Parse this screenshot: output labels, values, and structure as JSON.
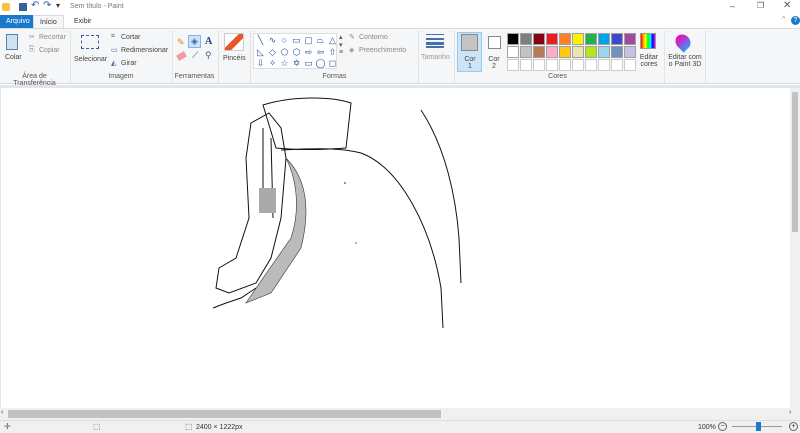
{
  "title": "Sem título - Paint",
  "tabs": {
    "file": "Arquivo",
    "home": "Início",
    "view": "Exibir"
  },
  "clipboard": {
    "paste": "Colar",
    "cut": "Recortar",
    "copy": "Copiar",
    "group": "Área de Transferência"
  },
  "image": {
    "select": "Selecionar",
    "crop": "Cortar",
    "resize": "Redimensionar",
    "rotate": "Girar",
    "group": "Imagem"
  },
  "tools": {
    "group": "Ferramentas"
  },
  "brushes": {
    "label": "Pincéis"
  },
  "shapes": {
    "outline": "Contorno",
    "fill": "Preenchimento",
    "group": "Formas",
    "glyphs": [
      "╲",
      "∿",
      "○",
      "▭",
      "▢",
      "⏢",
      "△",
      "◺",
      "◇",
      "⬠",
      "⬡",
      "⇨",
      "⇦",
      "⇧",
      "⇩",
      "✧",
      "☆",
      "✡",
      "▭",
      "◯",
      "◻"
    ]
  },
  "size": {
    "label": "Tamanho"
  },
  "colors": {
    "color1": "Cor 1",
    "color2": "Cor 2",
    "edit": "Editar cores",
    "paint3d": "Editar com o Paint 3D",
    "group": "Cores",
    "color1_value": "#c3c3c3",
    "color2_value": "#ffffff",
    "row1": [
      "#000000",
      "#7f7f7f",
      "#880015",
      "#ed1c24",
      "#ff7f27",
      "#fff200",
      "#22b14c",
      "#00a2e8",
      "#3f48cc",
      "#a349a4"
    ],
    "row2": [
      "#ffffff",
      "#c3c3c3",
      "#b97a57",
      "#ffaec9",
      "#ffc90e",
      "#efe4b0",
      "#b5e61d",
      "#99d9ea",
      "#7092be",
      "#c8bfe7"
    ]
  },
  "status": {
    "dimensions": "2400 × 1222px",
    "zoom": "100%"
  },
  "accent": "#1979ca"
}
